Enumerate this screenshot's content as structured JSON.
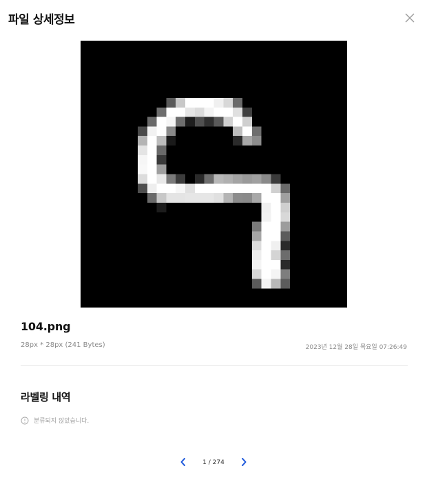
{
  "dialog": {
    "title": "파일 상세정보"
  },
  "file": {
    "name": "104.png",
    "meta": "28px * 28px (241 Bytes)",
    "date": "2023년 12월 28일 목요일 07:26:49"
  },
  "labeling": {
    "title": "라벨링 내역",
    "status": "분류되지 않았습니다."
  },
  "pager": {
    "text": "1 / 274"
  },
  "colors": {
    "accent": "#1a56db",
    "image_background": "#000000"
  },
  "icons": {
    "close": "close-icon",
    "info": "info-icon",
    "prev": "chevron-left-icon",
    "next": "chevron-right-icon"
  }
}
